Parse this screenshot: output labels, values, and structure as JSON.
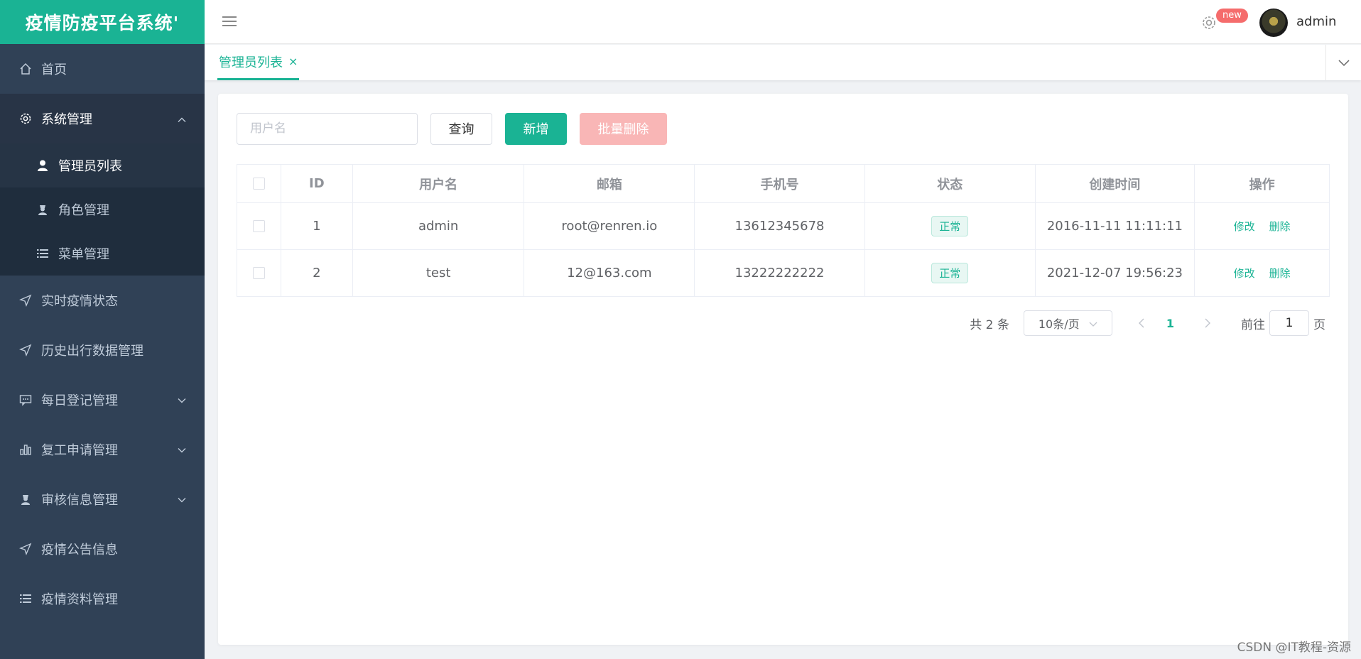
{
  "brand": {
    "title": "疫情防疫平台系统'"
  },
  "sidebar": {
    "items": [
      {
        "label": "首页",
        "icon": "home-icon"
      },
      {
        "label": "系统管理",
        "icon": "gear-icon",
        "expanded": true,
        "children": [
          {
            "label": "管理员列表",
            "icon": "user-icon",
            "active": true
          },
          {
            "label": "角色管理",
            "icon": "role-icon"
          },
          {
            "label": "菜单管理",
            "icon": "list-icon"
          }
        ]
      },
      {
        "label": "实时疫情状态",
        "icon": "send-icon"
      },
      {
        "label": "历史出行数据管理",
        "icon": "send-icon"
      },
      {
        "label": "每日登记管理",
        "icon": "message-icon",
        "expandable": true
      },
      {
        "label": "复工申请管理",
        "icon": "chart-icon",
        "expandable": true
      },
      {
        "label": "审核信息管理",
        "icon": "role-icon",
        "expandable": true
      },
      {
        "label": "疫情公告信息",
        "icon": "send-icon"
      },
      {
        "label": "疫情资料管理",
        "icon": "list-icon"
      }
    ]
  },
  "header": {
    "badge": "new",
    "username": "admin"
  },
  "tabs": [
    {
      "label": "管理员列表",
      "close": "×"
    }
  ],
  "toolbar": {
    "search_placeholder": "用户名",
    "query_label": "查询",
    "add_label": "新增",
    "batch_delete_label": "批量删除"
  },
  "table": {
    "headers": [
      "ID",
      "用户名",
      "邮箱",
      "手机号",
      "状态",
      "创建时间",
      "操作"
    ],
    "rows": [
      {
        "id": "1",
        "username": "admin",
        "email": "root@renren.io",
        "phone": "13612345678",
        "status": "正常",
        "created": "2016-11-11 11:11:11",
        "edit": "修改",
        "delete": "删除"
      },
      {
        "id": "2",
        "username": "test",
        "email": "12@163.com",
        "phone": "13222222222",
        "status": "正常",
        "created": "2021-12-07 19:56:23",
        "edit": "修改",
        "delete": "删除"
      }
    ]
  },
  "pagination": {
    "total_text": "共 2 条",
    "page_size": "10条/页",
    "current_page": "1",
    "goto_label": "前往",
    "goto_value": "1",
    "goto_unit": "页"
  },
  "colors": {
    "accent": "#1ab394",
    "sidebar_bg": "#304156",
    "danger_light": "#f9b6b6",
    "badge": "#f56c6c"
  },
  "watermark": "CSDN @IT教程-资源"
}
